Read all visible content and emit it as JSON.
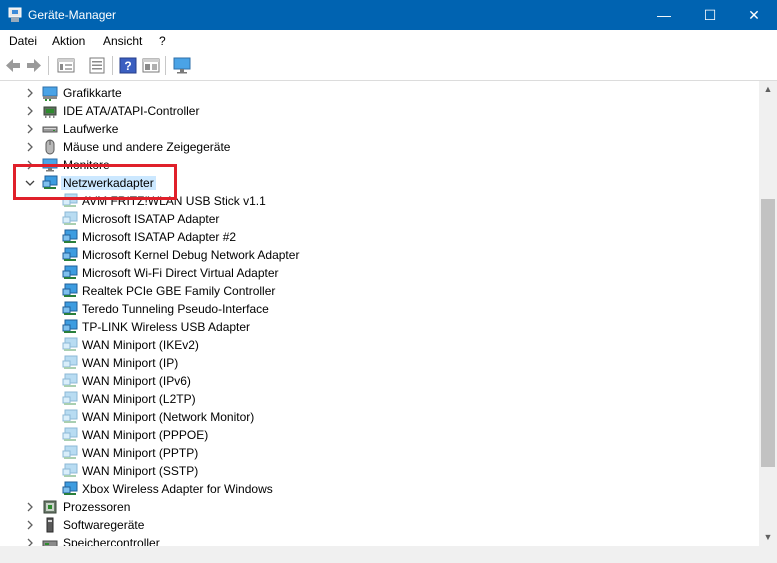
{
  "window": {
    "title": "Geräte-Manager",
    "controls": {
      "minimize": "—",
      "maximize": "☐",
      "close": "✕"
    }
  },
  "menu": [
    "Datei",
    "Aktion",
    "Ansicht",
    "?"
  ],
  "toolbar": [
    "back-icon",
    "forward-icon",
    "properties-icon",
    "list-icon",
    "help-icon",
    "view-icon",
    "monitor-icon"
  ],
  "tree": {
    "categories_top": [
      {
        "label": "Grafikkarte",
        "icon": "display-adapter-icon"
      },
      {
        "label": "IDE ATA/ATAPI-Controller",
        "icon": "ide-controller-icon"
      },
      {
        "label": "Laufwerke",
        "icon": "drive-icon"
      },
      {
        "label": "Mäuse und andere Zeigegeräte",
        "icon": "mouse-icon"
      },
      {
        "label": "Monitore",
        "icon": "monitor-icon"
      },
      {
        "label": "Netzwerkadapter",
        "icon": "network-adapter-icon",
        "expanded": true,
        "selected": true
      }
    ],
    "network_children": [
      {
        "label": "AVM FRITZ!WLAN USB Stick v1.1",
        "active": false
      },
      {
        "label": "Microsoft ISATAP Adapter",
        "active": false
      },
      {
        "label": "Microsoft ISATAP Adapter #2",
        "active": true
      },
      {
        "label": "Microsoft Kernel Debug Network Adapter",
        "active": true
      },
      {
        "label": "Microsoft Wi-Fi Direct Virtual Adapter",
        "active": true
      },
      {
        "label": "Realtek PCIe GBE Family Controller",
        "active": true
      },
      {
        "label": "Teredo Tunneling Pseudo-Interface",
        "active": true
      },
      {
        "label": "TP-LINK Wireless USB Adapter",
        "active": true
      },
      {
        "label": "WAN Miniport (IKEv2)",
        "active": false
      },
      {
        "label": "WAN Miniport (IP)",
        "active": false
      },
      {
        "label": "WAN Miniport (IPv6)",
        "active": false
      },
      {
        "label": "WAN Miniport (L2TP)",
        "active": false
      },
      {
        "label": "WAN Miniport (Network Monitor)",
        "active": false
      },
      {
        "label": "WAN Miniport (PPPOE)",
        "active": false
      },
      {
        "label": "WAN Miniport (PPTP)",
        "active": false
      },
      {
        "label": "WAN Miniport (SSTP)",
        "active": false
      },
      {
        "label": "Xbox Wireless Adapter for Windows",
        "active": true
      }
    ],
    "categories_bottom": [
      {
        "label": "Prozessoren",
        "icon": "processor-icon"
      },
      {
        "label": "Softwaregeräte",
        "icon": "software-device-icon"
      },
      {
        "label": "Speichercontroller",
        "icon": "storage-controller-icon"
      }
    ]
  },
  "colors": {
    "titlebar": "#0063b1",
    "selection": "#cce8ff",
    "highlight_box": "#e0202a"
  }
}
